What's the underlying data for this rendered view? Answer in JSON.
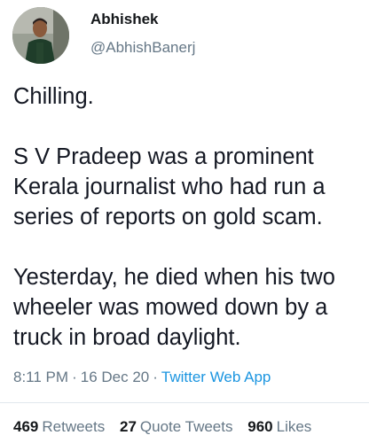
{
  "author": {
    "name": "Abhishek",
    "handle": "@AbhishBanerj"
  },
  "tweet": {
    "paragraphs": [
      "Chilling.",
      "S V Pradeep was a prominent Kerala journalist who had run a series of reports on gold scam.",
      "Yesterday, he died when his two wheeler was mowed down by a truck in broad daylight."
    ],
    "time": "8:11 PM",
    "date": "16 Dec 20",
    "separator": "·",
    "source": "Twitter Web App"
  },
  "stats": {
    "retweets_count": "469",
    "retweets_label": "Retweets",
    "quote_tweets_count": "27",
    "quote_tweets_label": "Quote Tweets",
    "likes_count": "960",
    "likes_label": "Likes"
  },
  "colors": {
    "link": "#1b95e0",
    "secondary_text": "#657786",
    "primary_text": "#141823"
  }
}
